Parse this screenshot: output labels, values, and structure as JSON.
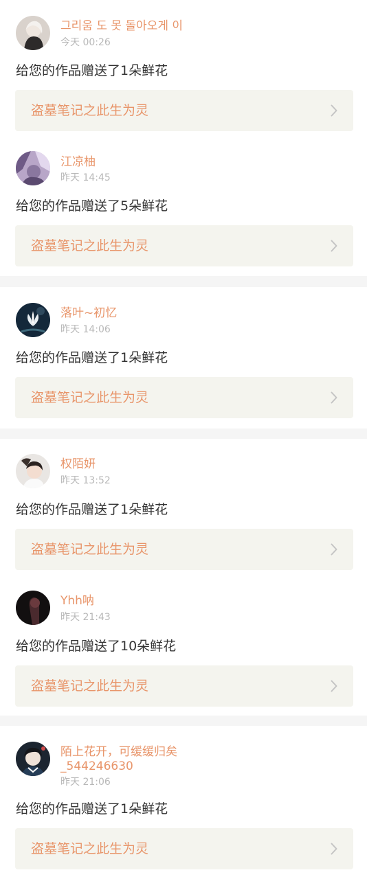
{
  "notifications": [
    {
      "username": "그리움 도 못 돌아오게 이",
      "time": "今天 00:26",
      "message": "给您的作品赠送了1朵鲜花",
      "work_title": "盗墓笔记之此生为灵",
      "avatar_icon": "avatar-girl-white-hair-icon"
    },
    {
      "username": "江凉柚",
      "time": "昨天 14:45",
      "message": "给您的作品赠送了5朵鲜花",
      "work_title": "盗墓笔记之此生为灵",
      "avatar_icon": "avatar-purple-anime-icon"
    },
    {
      "username": "落叶~初忆",
      "time": "昨天 14:06",
      "message": "给您的作品赠送了1朵鲜花",
      "work_title": "盗墓笔记之此生为灵",
      "avatar_icon": "avatar-lotus-icon"
    },
    {
      "username": "权陌妍",
      "time": "昨天 13:52",
      "message": "给您的作品赠送了1朵鲜花",
      "work_title": "盗墓笔记之此生为灵",
      "avatar_icon": "avatar-girl-photo-icon"
    },
    {
      "username": "Yhh呐",
      "time": "昨天 21:43",
      "message": "给您的作品赠送了10朵鲜花",
      "work_title": "盗墓笔记之此生为灵",
      "avatar_icon": "avatar-dark-silhouette-icon"
    },
    {
      "username": "陌上花开，可缓缓归矣\n_544246630",
      "time": "昨天 21:06",
      "message": "给您的作品赠送了1朵鲜花",
      "work_title": "盗墓笔记之此生为灵",
      "avatar_icon": "avatar-anime-boy-icon"
    }
  ],
  "colors": {
    "accent": "#e8956a",
    "text": "#333333",
    "muted": "#b8b8b8",
    "card_bg": "#f4f4ee",
    "separator": "#f5f5f5"
  }
}
